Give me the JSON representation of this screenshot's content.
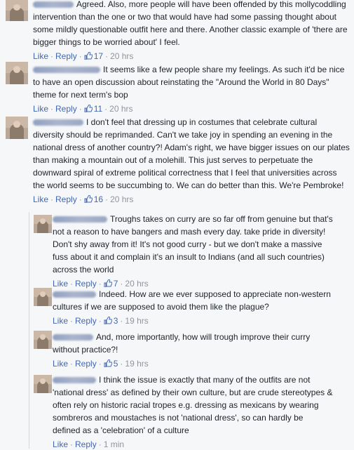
{
  "actions": {
    "like": "Like",
    "reply": "Reply",
    "separator": "·"
  },
  "comments": [
    {
      "text": "Agreed. Also, more people will have been offended by this mollycoddling intervention than the one or two that would have had some passing thought about some mildly questionable outfit here and there. Another classic example of 'there are bigger things to be worried about' I feel.",
      "likes": "17",
      "time": "20 hrs"
    },
    {
      "text": "It seems like a few people share my feelings. As such it'd be nice to have an open discussion about reinstating the \"Around the World in 80 Days\" theme for next term's bop",
      "likes": "11",
      "time": "20 hrs"
    },
    {
      "text": "I don't feel that dressing up in costumes that celebrate cultural diversity should be reprimanded. Can't we take joy in spending an evening in the national dress of another country?! Adam's right, we have bigger issues on our plates than making a mountain out of a molehill. This just serves to perpetuate the downward spiral of extreme political correctness that I feel that universities across the world seems to be succumbing to. We can do better than this. We're Pembroke!",
      "likes": "16",
      "time": "20 hrs"
    }
  ],
  "replies": [
    {
      "text": "Troughs takes on curry are so far off from genuine but that's not a reason to have bangers and mash every day. take pride in diversity! Don't shy away from it! It's not good curry - but we don't make a massive fuss about it and complain it's an insult to Indians (and all such countries) across the world",
      "likes": "7",
      "time": "20 hrs"
    },
    {
      "text": "Indeed. How are we ever supposed to appreciate non-western cultures if we are supposed to avoid them like the plague?",
      "likes": "3",
      "time": "19 hrs"
    },
    {
      "text": "And, more importantly, how will trough improve their curry without practice?!",
      "likes": "5",
      "time": "19 hrs"
    },
    {
      "text": "I think the issue is exactly that many of the outfits are not 'national dress' as defined by their own culture, but are crude stereotypes & often rely on historic racial tropes e.g. dressing as mexicans by wearing sombreros and moustaches is not 'national dress', so can hardly be defined as a 'celebration' of a culture",
      "time": "1 min"
    }
  ]
}
